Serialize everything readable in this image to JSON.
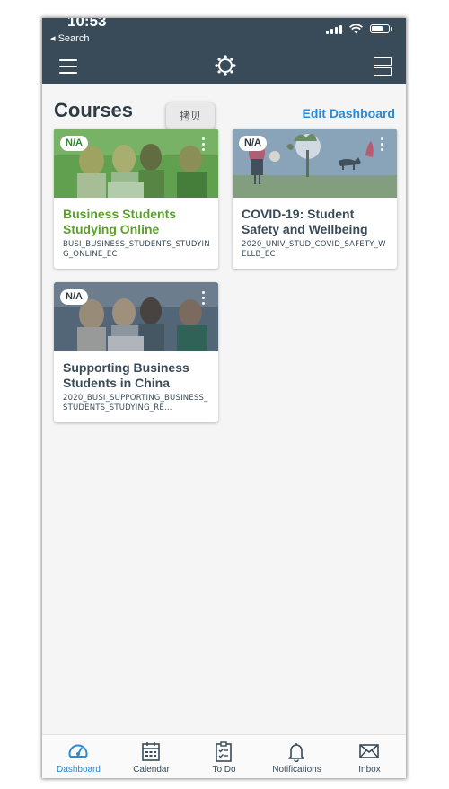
{
  "status_bar": {
    "time": "10:53",
    "back_label": "◂ Search"
  },
  "nav_bar": {
    "menu_icon": "hamburger-icon",
    "logo_icon": "canvas-logo-icon",
    "layout_icon": "layout-toggle-icon"
  },
  "dashboard": {
    "title": "Courses",
    "edit_label": "Edit Dashboard",
    "copy_tooltip": "拷贝"
  },
  "courses": [
    {
      "grade": "N/A",
      "name": "Business Students Studying Online",
      "code": "BUSI_BUSINESS_STUDENTS_STUDYING_ONLINE_EC",
      "name_color": "#5ca02c",
      "image_tint": "#4f9b3b"
    },
    {
      "grade": "N/A",
      "name": "COVID-19: Student Safety and Wellbeing",
      "code": "2020_UNIV_STUD_COVID_SAFETY_WELLB_EC",
      "name_color": "#394b58",
      "image_tint": "#6e88a0"
    },
    {
      "grade": "N/A",
      "name": "Supporting Business Students in China",
      "code": "2020_BUSI_SUPPORTING_BUSINESS_STUDENTS_STUDYING_RE...",
      "name_color": "#394b58",
      "image_tint": "#5c6f82"
    }
  ],
  "tab_bar": [
    {
      "label": "Dashboard",
      "icon": "dashboard-icon",
      "active": true
    },
    {
      "label": "Calendar",
      "icon": "calendar-icon",
      "active": false
    },
    {
      "label": "To Do",
      "icon": "todo-icon",
      "active": false
    },
    {
      "label": "Notifications",
      "icon": "bell-icon",
      "active": false
    },
    {
      "label": "Inbox",
      "icon": "envelope-icon",
      "active": false
    }
  ],
  "colors": {
    "header": "#394b58",
    "accent": "#2a8ad6",
    "background": "#f5f5f5"
  }
}
